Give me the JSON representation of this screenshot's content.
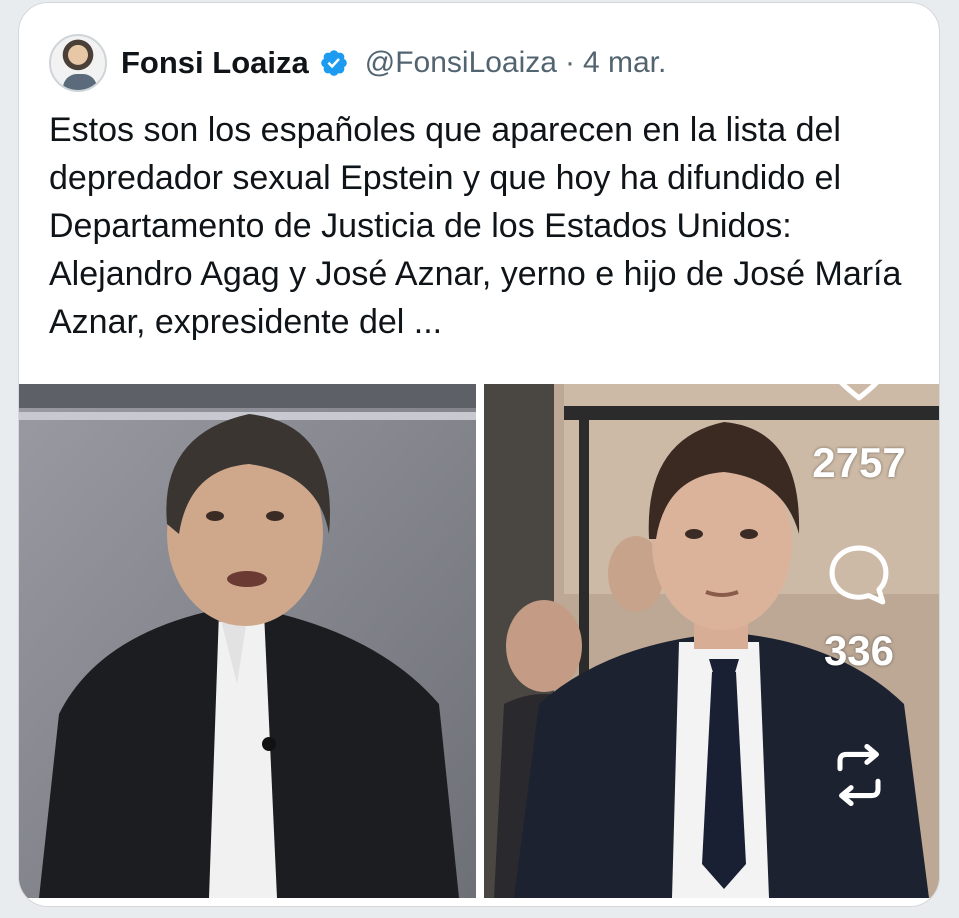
{
  "tweet": {
    "author_name": "Fonsi Loaiza",
    "handle": "@FonsiLoaiza",
    "separator": "·",
    "date": "4 mar.",
    "text": "Estos son los españoles que aparecen en la lista del depredador sexual Epstein y que hoy ha difundido el Departamento de Justicia de los Estados Unidos: Alejandro Agag y José Aznar, yerno e hijo de José María Aznar, expresidente del ..."
  },
  "actions": {
    "likes": "2757",
    "comments": "336"
  },
  "icons": {
    "verified": "verified-badge-icon",
    "like": "heart-icon",
    "comment": "comment-bubble-icon",
    "repost": "repost-icon"
  },
  "colors": {
    "verified_blue": "#1d9bf0",
    "text_primary": "#0f1419",
    "text_secondary": "#536471"
  }
}
